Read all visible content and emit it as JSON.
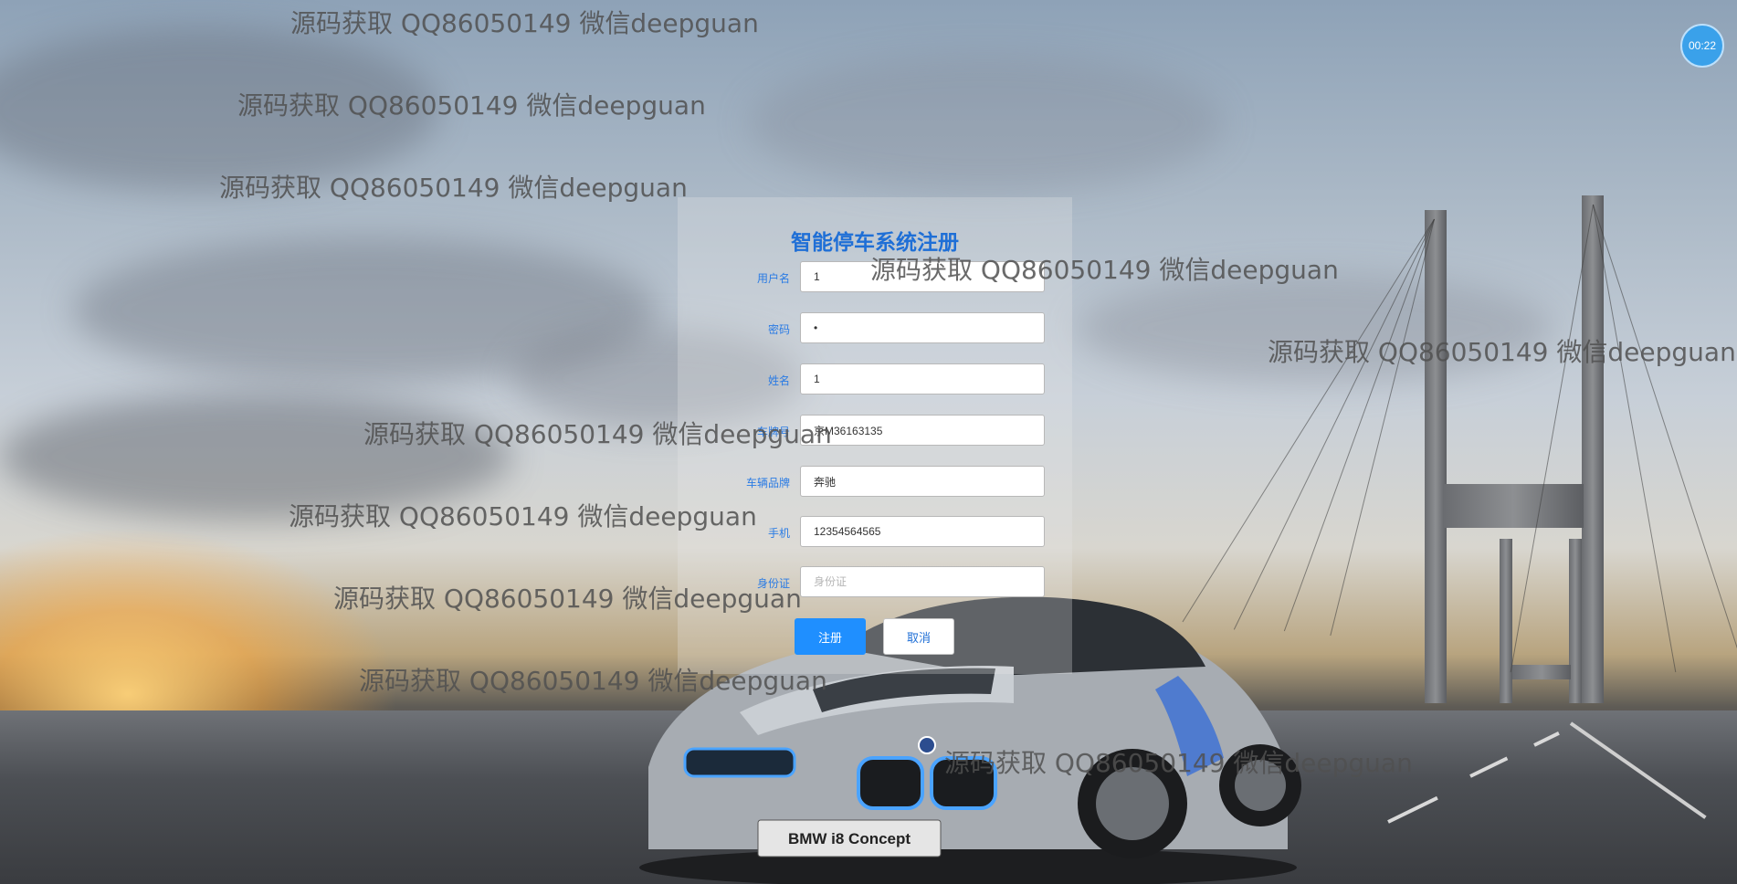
{
  "form": {
    "title": "智能停车系统注册",
    "fields": [
      {
        "label": "用户名",
        "value": "1",
        "placeholder": ""
      },
      {
        "label": "密码",
        "value": "•",
        "placeholder": ""
      },
      {
        "label": "姓名",
        "value": "1",
        "placeholder": ""
      },
      {
        "label": "车牌号",
        "value": "京M36163135",
        "placeholder": ""
      },
      {
        "label": "车辆品牌",
        "value": "奔驰",
        "placeholder": ""
      },
      {
        "label": "手机",
        "value": "12354564565",
        "placeholder": ""
      },
      {
        "label": "身份证",
        "value": "",
        "placeholder": "身份证"
      }
    ],
    "submit_label": "注册",
    "cancel_label": "取消"
  },
  "watermark": "源码获取 QQ86050149 微信deepguan",
  "timer": "00:22",
  "car_plate_text": "BMW i8 Concept",
  "colors": {
    "accent": "#1f8fff",
    "title": "#1f6fd6",
    "label": "#2a7be4"
  }
}
